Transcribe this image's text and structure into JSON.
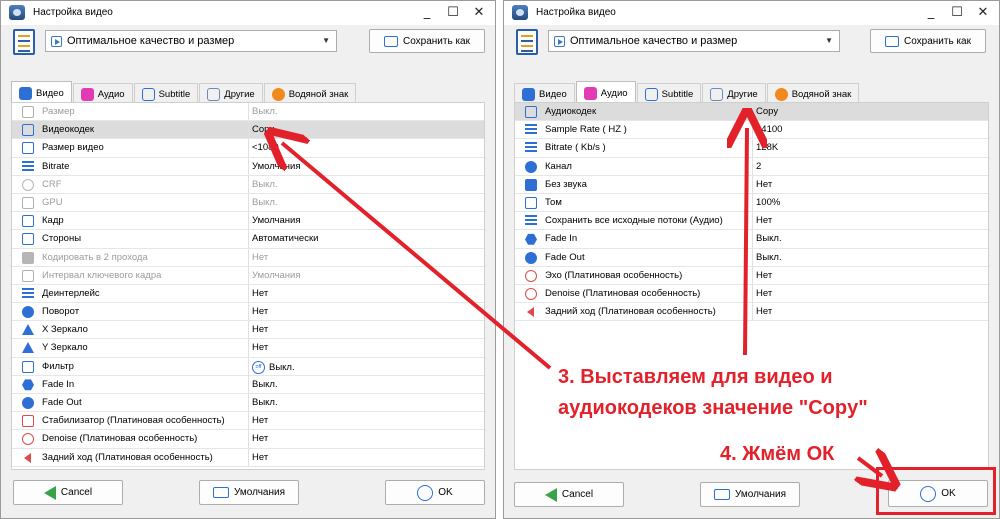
{
  "window_title": "Настройка видео",
  "window_controls": {
    "minimize": "_",
    "maximize": "☐",
    "close": "✕"
  },
  "profile": {
    "selected": "Оптимальное качество и размер"
  },
  "buttons": {
    "save_as": "Сохранить как",
    "cancel": "Cancel",
    "defaults": "Умолчания",
    "ok": "OK"
  },
  "tabs": [
    "Видео",
    "Аудио",
    "Subtitle",
    "Другие",
    "Водяной знак"
  ],
  "colors": {
    "accent": "#2e6fd6",
    "annotation_red": "#e3212a",
    "selected_row": "#dcdcdc"
  },
  "video_rows": [
    {
      "label": "Размер",
      "value": "Выкл.",
      "disabled": true,
      "icon": "size-icon"
    },
    {
      "label": "Видеокодек",
      "value": "Copy",
      "disabled": false,
      "icon": "codec-icon",
      "selected": true
    },
    {
      "label": "Размер видео",
      "value": "<1080",
      "disabled": false,
      "icon": "monitor-icon"
    },
    {
      "label": "Bitrate",
      "value": "Умолчания",
      "disabled": false,
      "icon": "bitrate-icon"
    },
    {
      "label": "CRF",
      "value": "Выкл.",
      "disabled": true,
      "icon": "crf-icon"
    },
    {
      "label": "GPU",
      "value": "Выкл.",
      "disabled": true,
      "icon": "gpu-icon"
    },
    {
      "label": "Кадр",
      "value": "Умолчания",
      "disabled": false,
      "icon": "frame-icon"
    },
    {
      "label": "Стороны",
      "value": "Автоматически",
      "disabled": false,
      "icon": "aspect-icon"
    },
    {
      "label": "Кодировать в 2 прохода",
      "value": "Нет",
      "disabled": true,
      "icon": "two-pass-icon"
    },
    {
      "label": "Интервал ключевого кадра",
      "value": "Умолчания",
      "disabled": true,
      "icon": "keyframe-icon"
    },
    {
      "label": "Деинтерлейс",
      "value": "Нет",
      "disabled": false,
      "icon": "deinterlace-icon"
    },
    {
      "label": "Поворот",
      "value": "Нет",
      "disabled": false,
      "icon": "rotate-icon"
    },
    {
      "label": "X Зеркало",
      "value": "Нет",
      "disabled": false,
      "icon": "x-mirror-icon"
    },
    {
      "label": "Y Зеркало",
      "value": "Нет",
      "disabled": false,
      "icon": "y-mirror-icon"
    },
    {
      "label": "Фильтр",
      "value": "Выкл.",
      "disabled": false,
      "icon": "filter-icon",
      "badge": "off"
    },
    {
      "label": "Fade In",
      "value": "Выкл.",
      "disabled": false,
      "icon": "fade-in-icon"
    },
    {
      "label": "Fade Out",
      "value": "Выкл.",
      "disabled": false,
      "icon": "fade-out-icon"
    },
    {
      "label": "Стабилизатор (Платиновая особенность)",
      "value": "Нет",
      "disabled": false,
      "icon": "stabilizer-icon"
    },
    {
      "label": "Denoise (Платиновая особенность)",
      "value": "Нет",
      "disabled": false,
      "icon": "denoise-icon"
    },
    {
      "label": "Задний ход (Платиновая особенность)",
      "value": "Нет",
      "disabled": false,
      "icon": "reverse-icon"
    }
  ],
  "audio_rows": [
    {
      "label": "Аудиокодек",
      "value": "Copy",
      "icon": "audio-codec-icon",
      "selected": true
    },
    {
      "label": "Sample Rate ( HZ )",
      "value": "44100",
      "icon": "sample-rate-icon"
    },
    {
      "label": "Bitrate ( Kb/s )",
      "value": "128K",
      "icon": "audio-bitrate-icon"
    },
    {
      "label": "Канал",
      "value": "2",
      "icon": "channel-icon"
    },
    {
      "label": "Без звука",
      "value": "Нет",
      "icon": "mute-icon"
    },
    {
      "label": "Том",
      "value": "100%",
      "icon": "volume-icon"
    },
    {
      "label": "Сохранить все исходные потоки (Аудио)",
      "value": "Нет",
      "icon": "streams-icon"
    },
    {
      "label": "Fade In",
      "value": "Выкл.",
      "icon": "fade-in-icon"
    },
    {
      "label": "Fade Out",
      "value": "Выкл.",
      "icon": "fade-out-icon"
    },
    {
      "label": "Эхо (Платиновая особенность)",
      "value": "Нет",
      "icon": "echo-icon"
    },
    {
      "label": "Denoise (Платиновая особенность)",
      "value": "Нет",
      "icon": "denoise-icon"
    },
    {
      "label": "Задний ход (Платиновая особенность)",
      "value": "Нет",
      "icon": "reverse-icon"
    }
  ],
  "annotations": {
    "step3_line1": "3. Выставляем для видео и",
    "step3_line2": "аудиокодеков значение \"Copy\"",
    "step4": "4. Жмём ОК"
  }
}
